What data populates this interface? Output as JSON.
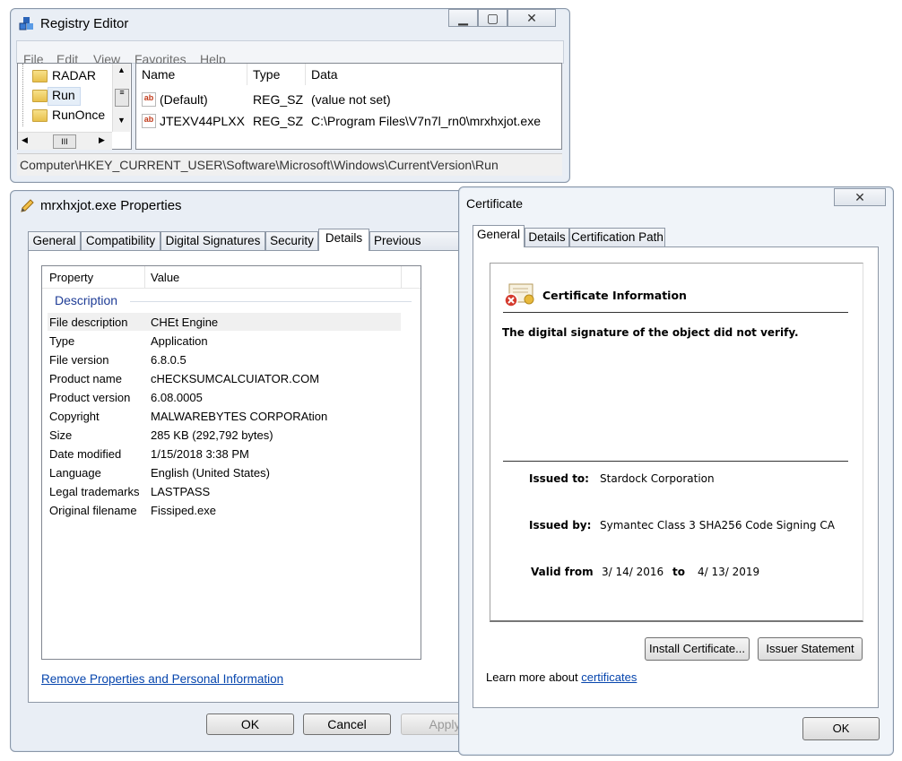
{
  "registry": {
    "title": "Registry Editor",
    "menu": [
      "File",
      "Edit",
      "View",
      "Favorites",
      "Help"
    ],
    "tree": [
      "RADAR",
      "Run",
      "RunOnce"
    ],
    "columns": [
      "Name",
      "Type",
      "Data"
    ],
    "rows": [
      {
        "name": "(Default)",
        "type": "REG_SZ",
        "data": "(value not set)"
      },
      {
        "name": "JTEXV44PLXX",
        "type": "REG_SZ",
        "data": "C:\\Program Files\\V7n7l_rn0\\mrxhxjot.exe"
      }
    ],
    "status_path": "Computer\\HKEY_CURRENT_USER\\Software\\Microsoft\\Windows\\CurrentVersion\\Run",
    "icon_label": "ab",
    "scroll_thumb": "III"
  },
  "properties": {
    "title": "mrxhxjot.exe Properties",
    "tabs": [
      "General",
      "Compatibility",
      "Digital Signatures",
      "Security",
      "Details",
      "Previous Versions"
    ],
    "active_tab": "Details",
    "columns": [
      "Property",
      "Value"
    ],
    "section": "Description",
    "rows": [
      {
        "k": "File description",
        "v": "CHEt Engine"
      },
      {
        "k": "Type",
        "v": "Application"
      },
      {
        "k": "File version",
        "v": "6.8.0.5"
      },
      {
        "k": "Product name",
        "v": "cHECKSUMCALCUIATOR.COM"
      },
      {
        "k": "Product version",
        "v": "6.08.0005"
      },
      {
        "k": "Copyright",
        "v": "MALWAREBYTES CORPORAtion"
      },
      {
        "k": "Size",
        "v": "285 KB (292,792 bytes)"
      },
      {
        "k": "Date modified",
        "v": "1/15/2018 3:38 PM"
      },
      {
        "k": "Language",
        "v": "English (United States)"
      },
      {
        "k": "Legal trademarks",
        "v": "LASTPASS"
      },
      {
        "k": "Original filename",
        "v": "Fissiped.exe"
      }
    ],
    "remove_link": "Remove Properties and Personal Information",
    "ok": "OK",
    "cancel": "Cancel",
    "apply": "Apply"
  },
  "certificate": {
    "title": "Certificate",
    "tabs": [
      "General",
      "Details",
      "Certification Path"
    ],
    "info_title": "Certificate Information",
    "warning": "The digital signature of the object did not verify.",
    "issued_to_label": "Issued to:",
    "issued_to": "Stardock Corporation",
    "issued_by_label": "Issued by:",
    "issued_by": "Symantec Class 3 SHA256 Code Signing CA",
    "valid_from_label": "Valid from",
    "valid_from": "3/ 14/ 2016",
    "to_label": "to",
    "valid_to": "4/ 13/ 2019",
    "install_button": "Install Certificate...",
    "issuer_button": "Issuer Statement",
    "learn_prefix": "Learn more about ",
    "learn_link": "certificates",
    "ok": "OK"
  }
}
